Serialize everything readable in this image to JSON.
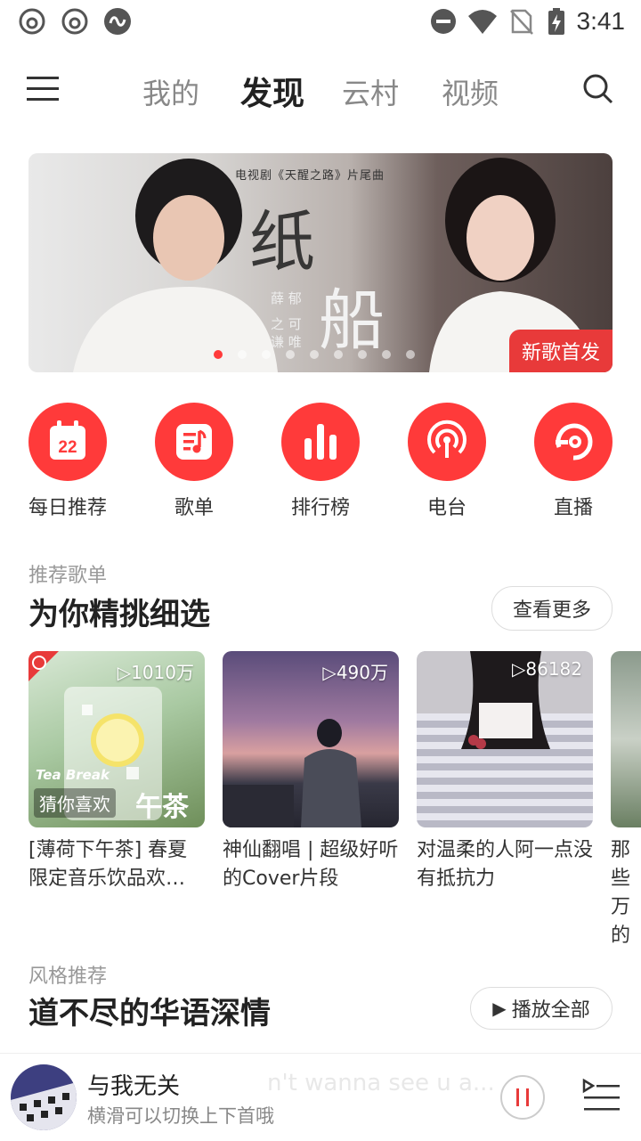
{
  "status_bar": {
    "time": "3:41",
    "left_icons": [
      "netease-app-icon",
      "netease-app-icon",
      "infinity-app-icon"
    ],
    "right_icons": [
      "dnd-icon",
      "wifi-icon",
      "no-sim-icon",
      "battery-charging-icon"
    ]
  },
  "header": {
    "tabs": [
      {
        "label": "我的",
        "active": false
      },
      {
        "label": "发现",
        "active": true
      },
      {
        "label": "云村",
        "active": false
      },
      {
        "label": "视频",
        "active": false
      }
    ]
  },
  "banner": {
    "caption": "电视剧《天醒之路》片尾曲",
    "title_big_1": "纸",
    "title_big_2": "船",
    "artist_1": "薛 郁",
    "artist_2": "之 可\n谦 唯",
    "badge": "新歌首发",
    "dot_count": 9,
    "active_dot": 0
  },
  "shortcuts": [
    {
      "label": "每日推荐",
      "icon": "calendar-icon",
      "day": "22"
    },
    {
      "label": "歌单",
      "icon": "playlist-icon"
    },
    {
      "label": "排行榜",
      "icon": "chart-bars-icon"
    },
    {
      "label": "电台",
      "icon": "radio-icon"
    },
    {
      "label": "直播",
      "icon": "live-icon"
    }
  ],
  "recommend": {
    "subtitle": "推荐歌单",
    "title": "为你精挑细选",
    "more_label": "查看更多",
    "cards": [
      {
        "plays": "1010万",
        "title": "[薄荷下午茶] 春夏限定音乐饮品欢…",
        "tag": "猜你喜欢",
        "overlay_en": "Tea Break",
        "overlay_cn": "午茶"
      },
      {
        "plays": "490万",
        "title": "神仙翻唱 | 超级好听的Cover片段"
      },
      {
        "plays": "86182",
        "title": "对温柔的人阿一点没有抵抗力"
      },
      {
        "plays": "",
        "title": "那些万的"
      }
    ]
  },
  "style": {
    "subtitle": "风格推荐",
    "title": "道不尽的华语深情",
    "play_all_label": "播放全部"
  },
  "player": {
    "song": "与我无关",
    "hint": "横滑可以切换上下首哦",
    "behind_text": "n't wanna see u a..."
  },
  "colors": {
    "accent": "#ff3a3a",
    "text_primary": "#222222",
    "text_secondary": "#999999"
  }
}
